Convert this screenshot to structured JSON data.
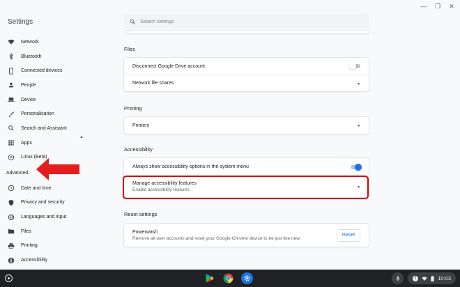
{
  "app": {
    "title": "Settings"
  },
  "search": {
    "placeholder": "Search settings"
  },
  "sidebar": {
    "items": [
      {
        "label": "Network",
        "icon": "wifi-icon"
      },
      {
        "label": "Bluetooth",
        "icon": "bluetooth-icon"
      },
      {
        "label": "Connected devices",
        "icon": "phone-icon"
      },
      {
        "label": "People",
        "icon": "person-icon"
      },
      {
        "label": "Device",
        "icon": "laptop-icon"
      },
      {
        "label": "Personalisation",
        "icon": "brush-icon"
      },
      {
        "label": "Search and Assistant",
        "icon": "search-icon"
      },
      {
        "label": "Apps",
        "icon": "apps-grid-icon"
      },
      {
        "label": "Linux (Beta)",
        "icon": "linux-icon"
      }
    ],
    "advanced_label": "Advanced",
    "advanced_items": [
      {
        "label": "Date and time",
        "icon": "clock-icon"
      },
      {
        "label": "Privacy and security",
        "icon": "shield-icon"
      },
      {
        "label": "Languages and input",
        "icon": "globe-icon"
      },
      {
        "label": "Files",
        "icon": "folder-icon"
      },
      {
        "label": "Printing",
        "icon": "printer-icon"
      },
      {
        "label": "Accessibility",
        "icon": "accessibility-icon"
      }
    ]
  },
  "main": {
    "files": {
      "title": "Files",
      "rows": {
        "disconnect": {
          "label": "Disconnect Google Drive account",
          "toggle": "off"
        },
        "network_shares": {
          "label": "Network file shares"
        }
      }
    },
    "printing": {
      "title": "Printing",
      "printers_label": "Printers"
    },
    "accessibility": {
      "title": "Accessibility",
      "always_show_label": "Always show accessibility options in the system menu",
      "always_show_toggle": "on",
      "manage_label": "Manage accessibility features",
      "manage_sub": "Enable accessibility features"
    },
    "reset": {
      "title": "Reset settings",
      "powerwash_label": "Powerwash",
      "powerwash_desc": "Remove all user accounts and reset your Google Chrome device to be just like new.",
      "reset_button": "Reset"
    }
  },
  "shelf": {
    "apps": [
      {
        "name": "Play Store",
        "icon": "play-store-icon"
      },
      {
        "name": "Chrome",
        "icon": "chrome-icon"
      },
      {
        "name": "Settings",
        "icon": "settings-gear-icon"
      }
    ],
    "time": "10:03"
  },
  "colors": {
    "accent": "#1a73e8",
    "highlight": "#d50000",
    "arrow": "#e41d1d",
    "shelf": "#202124"
  }
}
